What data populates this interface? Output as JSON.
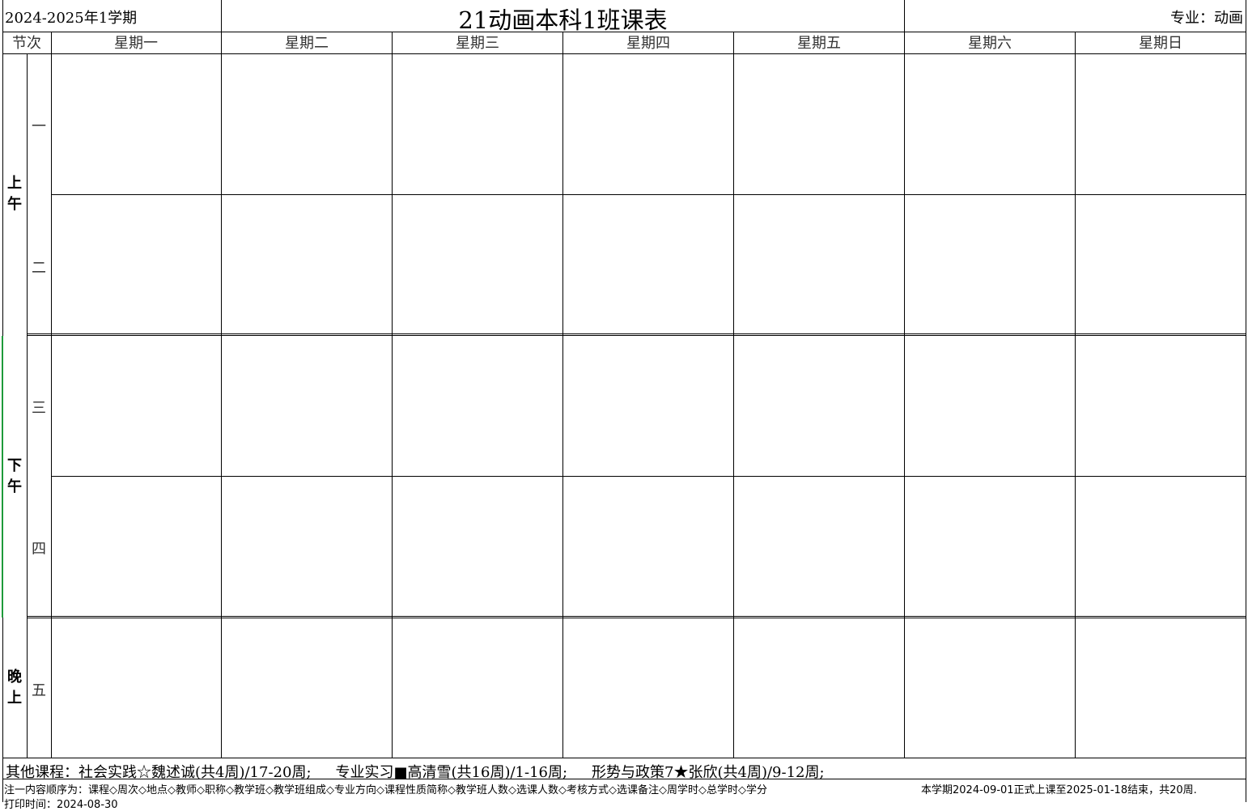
{
  "header": {
    "term": "2024-2025年1学期",
    "title": "21动画本科1班课表",
    "major": "专业：动画"
  },
  "table": {
    "corner_label": "节次",
    "days": [
      "星期一",
      "星期二",
      "星期三",
      "星期四",
      "星期五",
      "星期六",
      "星期日"
    ],
    "sessions": [
      "上午",
      "下午",
      "晚上"
    ],
    "periods": [
      "一",
      "二",
      "三",
      "四",
      "五"
    ],
    "session_chars": {
      "morning": [
        "上",
        "午"
      ],
      "afternoon": [
        "下",
        "午"
      ],
      "evening": [
        "晚",
        "上"
      ]
    }
  },
  "footer": {
    "other_courses_label": "其他课程：",
    "other_courses": [
      "社会实践☆魏述诚(共4周)/17-20周;",
      "专业实习■高清雪(共16周)/1-16周;",
      "形势与政策7★张欣(共4周)/9-12周;"
    ],
    "note": "注一内容顺序为：课程◇周次◇地点◇教师◇职称◇教学班◇教学班组成◇专业方向◇课程性质简称◇教学班人数◇选课人数◇考核方式◇选课备注◇周学时◇总学时◇学分",
    "semester_info": "本学期2024-09-01正式上课至2025-01-18结束，共20周.",
    "print_time": "打印时间：2024-08-30"
  }
}
